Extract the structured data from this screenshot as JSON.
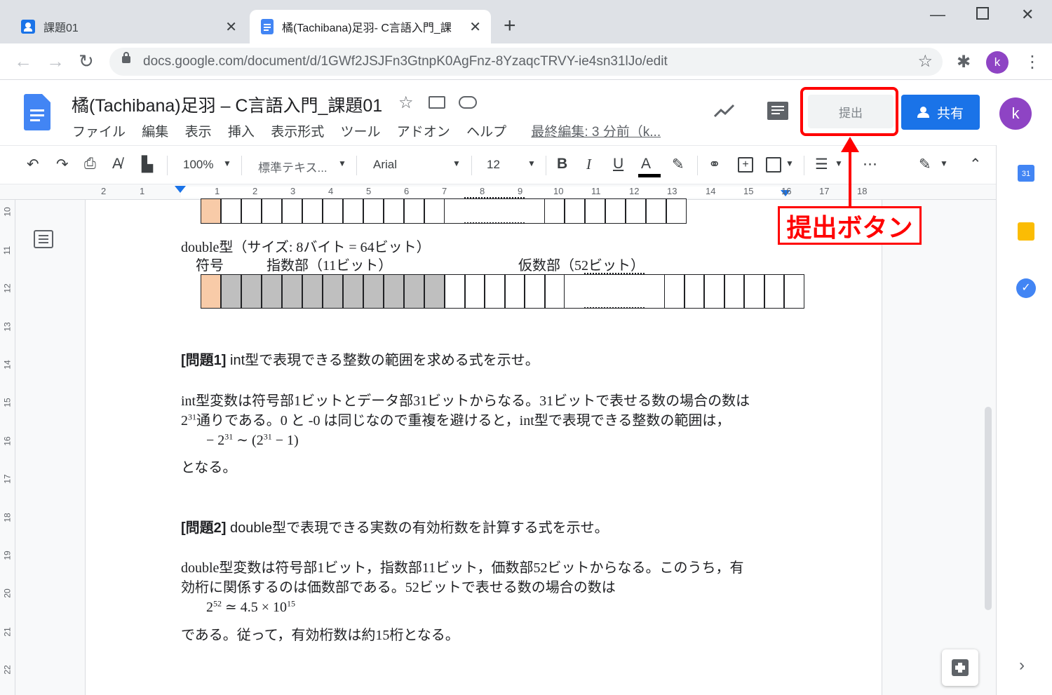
{
  "tabs": [
    {
      "title": "課題01",
      "active": false
    },
    {
      "title": "橘(Tachibana)足羽- C言語入門_課",
      "active": true
    }
  ],
  "address": {
    "url": "docs.google.com/document/d/1GWf2JSJFn3GtnpK0AgFnz-8YzaqcTRVY-ie4sn31lJo/edit"
  },
  "profile_initial": "k",
  "doc": {
    "title": "橘(Tachibana)足羽 – C言語入門_課題01",
    "menu": [
      "ファイル",
      "編集",
      "表示",
      "挿入",
      "表示形式",
      "ツール",
      "アドオン",
      "ヘルプ"
    ],
    "last_edit": "最終編集: 3 分前（k..."
  },
  "header_buttons": {
    "submit": "提出",
    "share": "共有",
    "avatar": "k"
  },
  "toolbar": {
    "zoom": "100%",
    "style": "標準テキス...",
    "font": "Arial",
    "size": "12"
  },
  "ruler_top": [
    "2",
    "1",
    "1",
    "2",
    "3",
    "4",
    "5",
    "6",
    "7",
    "8",
    "9",
    "10",
    "11",
    "12",
    "13",
    "14",
    "15",
    "16",
    "17",
    "18"
  ],
  "ruler_left": [
    "10",
    "11",
    "12",
    "13",
    "14",
    "15",
    "16",
    "17",
    "18",
    "19",
    "20",
    "21",
    "22"
  ],
  "content": {
    "double_caption": "double型（サイズ: 8バイト = 64ビット）",
    "label_sign": "符号",
    "label_exp": "指数部（11ビット）",
    "label_mant": "仮数部（52ビット）",
    "q1_title": "[問題1]",
    "q1_text": " int型で表現できる整数の範囲を求める式を示せ。",
    "a1_line1": "int型変数は符号部1ビットとデータ部31ビットからなる。31ビットで表せる数の場合の数は",
    "a1_line2_base": "2",
    "a1_line2_exp": "31",
    "a1_line2_rest": "通りである。0 と -0 は同じなので重複を避けると，int型で表現できる整数の範囲は，",
    "a1_formula_a": "− 2",
    "a1_formula_exp1": "31",
    "a1_formula_b": " ∼ (2",
    "a1_formula_exp2": "31",
    "a1_formula_c": " − 1)",
    "a1_line4": "となる。",
    "q2_title": "[問題2]",
    "q2_text": " double型で表現できる実数の有効桁数を計算する式を示せ。",
    "a2_line1": "double型変数は符号部1ビット，指数部11ビット，価数部52ビットからなる。このうち，有",
    "a2_line2": "効桁に関係するのは価数部である。52ビットで表せる数の場合の数は",
    "a2_formula_a": "2",
    "a2_formula_exp1": "52",
    "a2_formula_b": " ≃ 4.5 × 10",
    "a2_formula_exp2": "15",
    "a2_line4": "である。従って，有効桁数は約15桁となる。"
  },
  "annotation": {
    "label": "提出ボタン"
  },
  "colors": {
    "accent": "#1a73e8",
    "annotation": "#ff0000",
    "sign_bit": "#f8cba8",
    "exp_bit": "#bfbfbf"
  }
}
